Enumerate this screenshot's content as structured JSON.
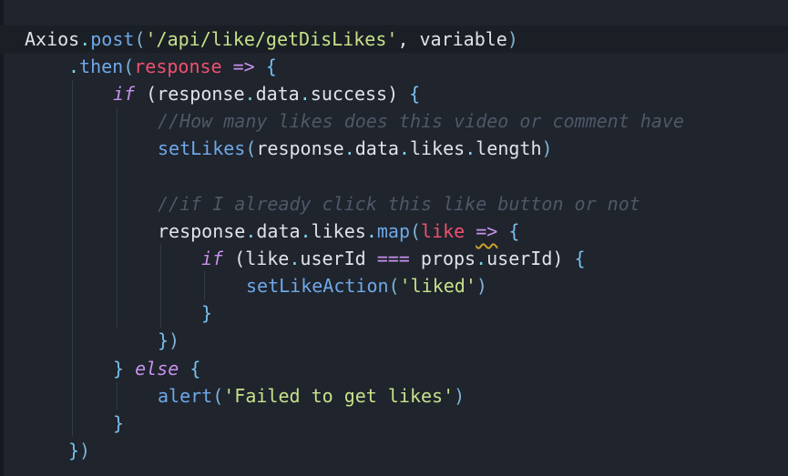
{
  "editor": {
    "background": "#1f242d",
    "colors": {
      "function": "#6fa8e8",
      "string": "#c9e08a",
      "parameter": "#f0506e",
      "keyword": "#c792ea",
      "comment": "#4f5867"
    }
  },
  "code": {
    "l1": {
      "obj": "Axios",
      "dot": ".",
      "fn": "post",
      "open": "(",
      "str": "'/api/like/getDisLikes'",
      "rest": ", variable",
      "close": ")"
    },
    "l2": {
      "dot": ".",
      "fn": "then",
      "open": "(",
      "param": "response",
      "arrow": " => ",
      "brace": "{"
    },
    "l3": {
      "kw": "if",
      "open": " (",
      "a": "response",
      "d1": ".",
      "b": "data",
      "d2": ".",
      "c": "success",
      "close": ") ",
      "brace": "{"
    },
    "l4": {
      "comment": "//How many likes does this video or comment have"
    },
    "l5": {
      "fn": "setLikes",
      "open": "(",
      "a": "response",
      "d1": ".",
      "b": "data",
      "d2": ".",
      "c": "likes",
      "d3": ".",
      "e": "length",
      "close": ")"
    },
    "l7": {
      "comment": "//if I already click this like button or not"
    },
    "l8": {
      "a": "response",
      "d1": ".",
      "b": "data",
      "d2": ".",
      "c": "likes",
      "d3": ".",
      "fn": "map",
      "open": "(",
      "param": "like",
      "sp": " ",
      "arrow": "=>",
      "sp2": " ",
      "brace": "{"
    },
    "l9": {
      "kw": "if",
      "open": " (",
      "a": "like",
      "d1": ".",
      "b": "userId",
      "op": " === ",
      "c": "props",
      "d2": ".",
      "e": "userId",
      "close": ") ",
      "brace": "{"
    },
    "l10": {
      "fn": "setLikeAction",
      "open": "(",
      "str": "'liked'",
      "close": ")"
    },
    "l11": {
      "brace": "}"
    },
    "l12": {
      "brace": "}",
      "close": ")"
    },
    "l13": {
      "brace1": "} ",
      "kw": "else",
      "sp": " ",
      "brace2": "{"
    },
    "l14": {
      "fn": "alert",
      "open": "(",
      "str": "'Failed to get likes'",
      "close": ")"
    },
    "l15": {
      "brace": "}"
    },
    "l16": {
      "brace": "}",
      "close": ")"
    }
  }
}
